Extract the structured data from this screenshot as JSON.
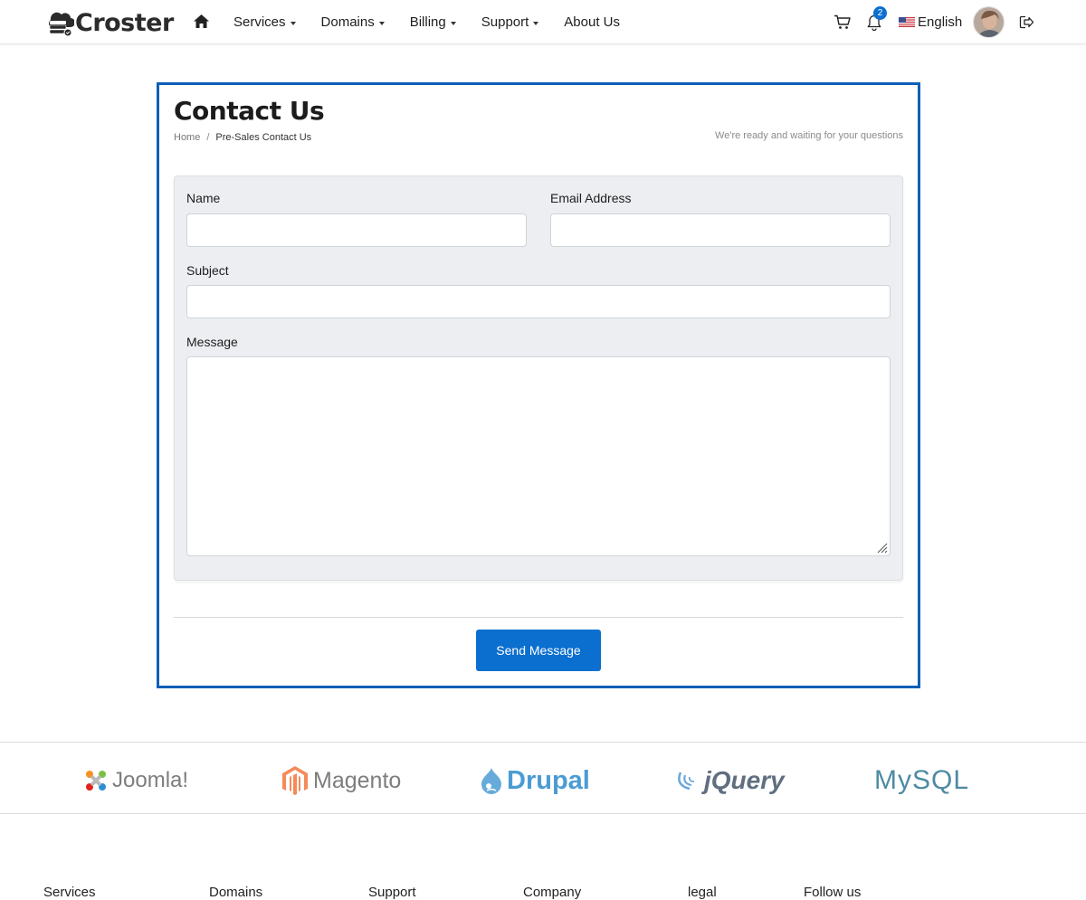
{
  "header": {
    "brand": "Croster",
    "nav": [
      {
        "label": "Services",
        "dropdown": true
      },
      {
        "label": "Domains",
        "dropdown": true
      },
      {
        "label": "Billing",
        "dropdown": true
      },
      {
        "label": "Support",
        "dropdown": true
      },
      {
        "label": "About Us",
        "dropdown": false
      }
    ],
    "notification_count": "2",
    "language": "English",
    "icons": [
      "home-icon",
      "cart-icon",
      "bell-icon",
      "us-flag-icon",
      "avatar",
      "logout-icon"
    ]
  },
  "page": {
    "title": "Contact Us",
    "breadcrumb": {
      "home": "Home",
      "separator": "/",
      "current": "Pre-Sales Contact Us"
    },
    "tagline": "We're ready and waiting for your questions"
  },
  "form": {
    "name_label": "Name",
    "name_value": "",
    "email_label": "Email Address",
    "email_value": "",
    "subject_label": "Subject",
    "subject_value": "",
    "message_label": "Message",
    "message_value": "",
    "submit_label": "Send Message"
  },
  "logos": [
    "Joomla!",
    "Magento",
    "Drupal",
    "jQuery",
    "MySQL"
  ],
  "footer": {
    "columns": [
      "Services",
      "Domains",
      "Support",
      "Company",
      "legal",
      "Follow us"
    ]
  },
  "colors": {
    "accent": "#0b6fcf",
    "card_border": "#0d5fb6",
    "panel_bg": "#eceef1"
  }
}
